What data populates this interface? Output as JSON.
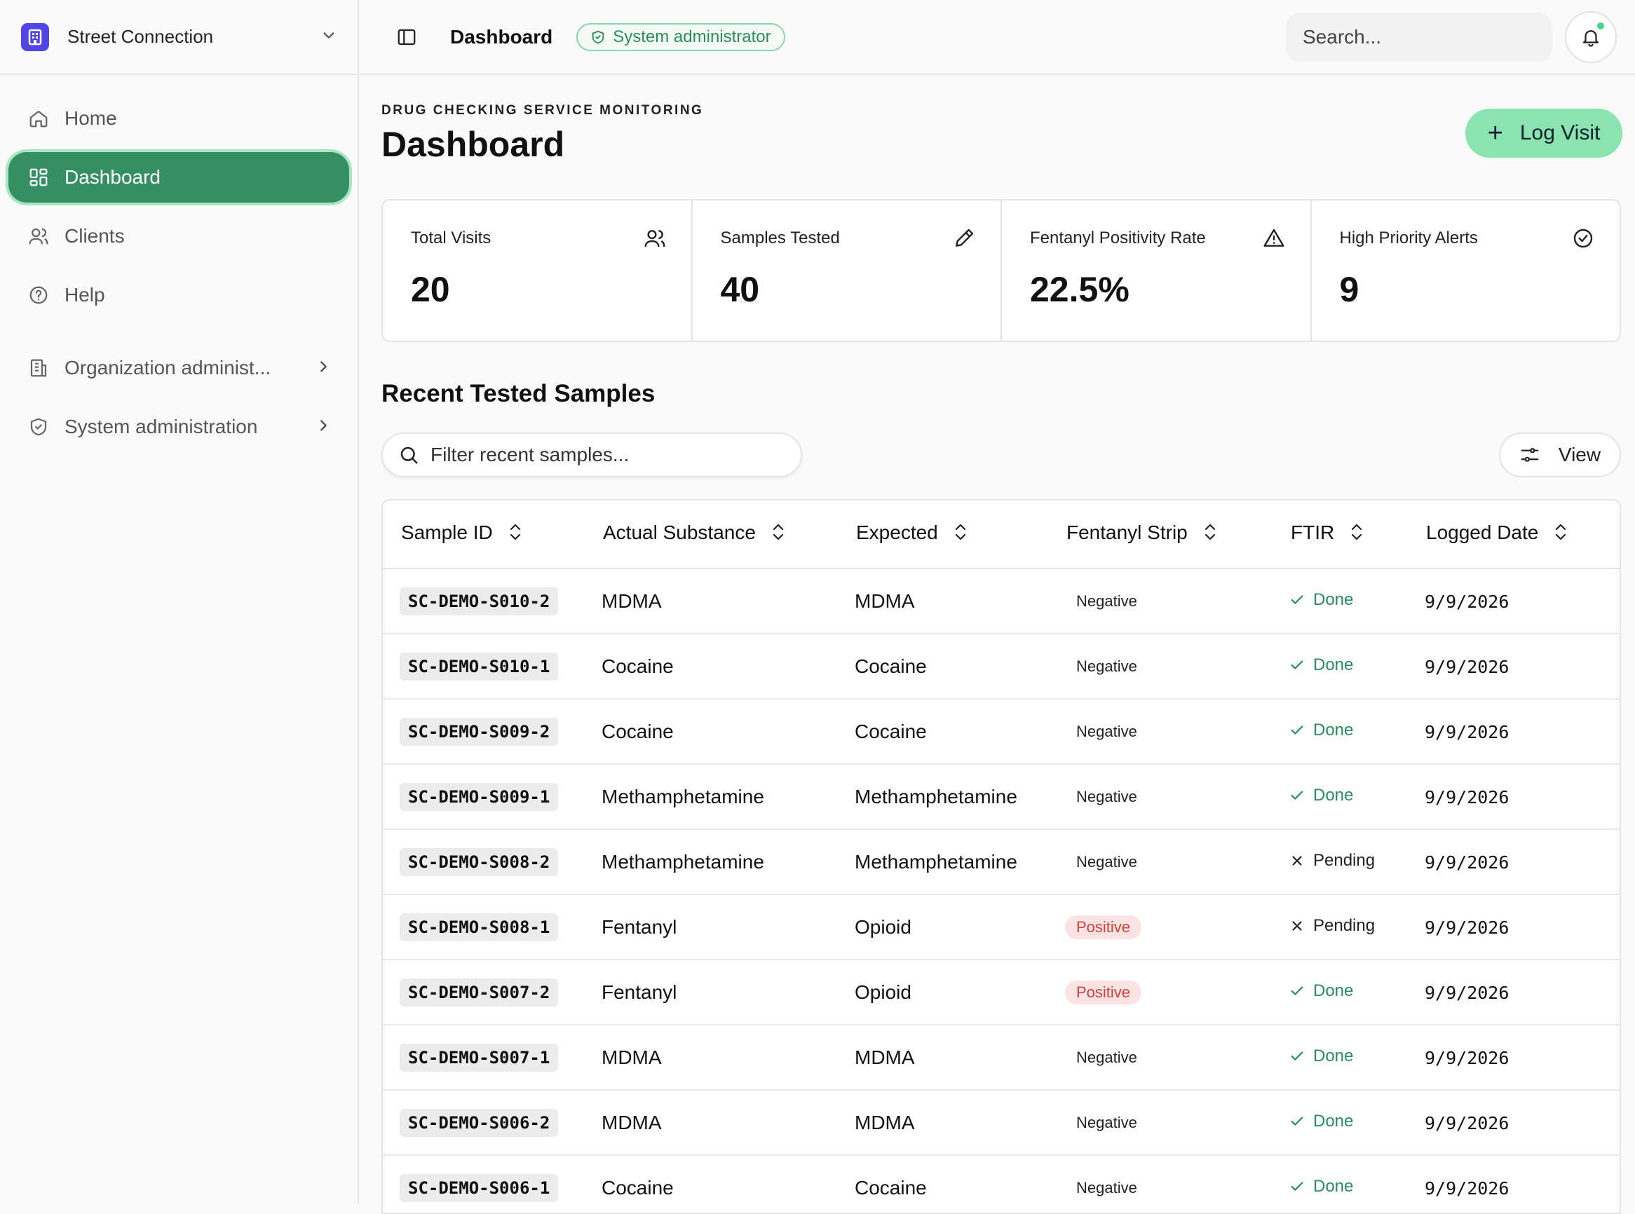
{
  "org": {
    "name": "Street Connection"
  },
  "nav": {
    "items": [
      {
        "label": "Home",
        "icon": "home-icon"
      },
      {
        "label": "Dashboard",
        "icon": "dashboard-icon",
        "active": true
      },
      {
        "label": "Clients",
        "icon": "users-icon"
      },
      {
        "label": "Help",
        "icon": "help-icon"
      },
      {
        "label": "Organization administ...",
        "icon": "building-icon",
        "expandable": true
      },
      {
        "label": "System administration",
        "icon": "shield-icon",
        "expandable": true
      }
    ]
  },
  "topbar": {
    "title": "Dashboard",
    "role_badge": "System administrator",
    "search_placeholder": "Search..."
  },
  "page": {
    "eyebrow": "DRUG CHECKING SERVICE MONITORING",
    "title": "Dashboard",
    "log_visit_label": "Log Visit"
  },
  "stats": [
    {
      "label": "Total Visits",
      "value": "20",
      "icon": "users-icon"
    },
    {
      "label": "Samples Tested",
      "value": "40",
      "icon": "pipette-icon"
    },
    {
      "label": "Fentanyl Positivity Rate",
      "value": "22.5%",
      "icon": "alert-triangle-icon"
    },
    {
      "label": "High Priority Alerts",
      "value": "9",
      "icon": "check-circle-icon"
    }
  ],
  "samples": {
    "section_title": "Recent Tested Samples",
    "filter_placeholder": "Filter recent samples...",
    "view_label": "View",
    "columns": [
      "Sample ID",
      "Actual Substance",
      "Expected",
      "Fentanyl Strip",
      "FTIR",
      "Logged Date"
    ],
    "rows": [
      {
        "id": "SC-DEMO-S010-2",
        "actual": "MDMA",
        "expected": "MDMA",
        "strip": "Negative",
        "ftir": "Done",
        "date": "9/9/2026"
      },
      {
        "id": "SC-DEMO-S010-1",
        "actual": "Cocaine",
        "expected": "Cocaine",
        "strip": "Negative",
        "ftir": "Done",
        "date": "9/9/2026"
      },
      {
        "id": "SC-DEMO-S009-2",
        "actual": "Cocaine",
        "expected": "Cocaine",
        "strip": "Negative",
        "ftir": "Done",
        "date": "9/9/2026"
      },
      {
        "id": "SC-DEMO-S009-1",
        "actual": "Methamphetamine",
        "expected": "Methamphetamine",
        "strip": "Negative",
        "ftir": "Done",
        "date": "9/9/2026"
      },
      {
        "id": "SC-DEMO-S008-2",
        "actual": "Methamphetamine",
        "expected": "Methamphetamine",
        "strip": "Negative",
        "ftir": "Pending",
        "date": "9/9/2026"
      },
      {
        "id": "SC-DEMO-S008-1",
        "actual": "Fentanyl",
        "expected": "Opioid",
        "strip": "Positive",
        "ftir": "Pending",
        "date": "9/9/2026"
      },
      {
        "id": "SC-DEMO-S007-2",
        "actual": "Fentanyl",
        "expected": "Opioid",
        "strip": "Positive",
        "ftir": "Done",
        "date": "9/9/2026"
      },
      {
        "id": "SC-DEMO-S007-1",
        "actual": "MDMA",
        "expected": "MDMA",
        "strip": "Negative",
        "ftir": "Done",
        "date": "9/9/2026"
      },
      {
        "id": "SC-DEMO-S006-2",
        "actual": "MDMA",
        "expected": "MDMA",
        "strip": "Negative",
        "ftir": "Done",
        "date": "9/9/2026"
      },
      {
        "id": "SC-DEMO-S006-1",
        "actual": "Cocaine",
        "expected": "Cocaine",
        "strip": "Negative",
        "ftir": "Done",
        "date": "9/9/2026"
      }
    ]
  },
  "colors": {
    "accent": "#358f63",
    "accent_light": "#8be3af",
    "positive_bg": "#fbe3e3",
    "positive_text": "#d2423a",
    "done_text": "#2c8b5c",
    "org_logo": "#4f46e5"
  }
}
